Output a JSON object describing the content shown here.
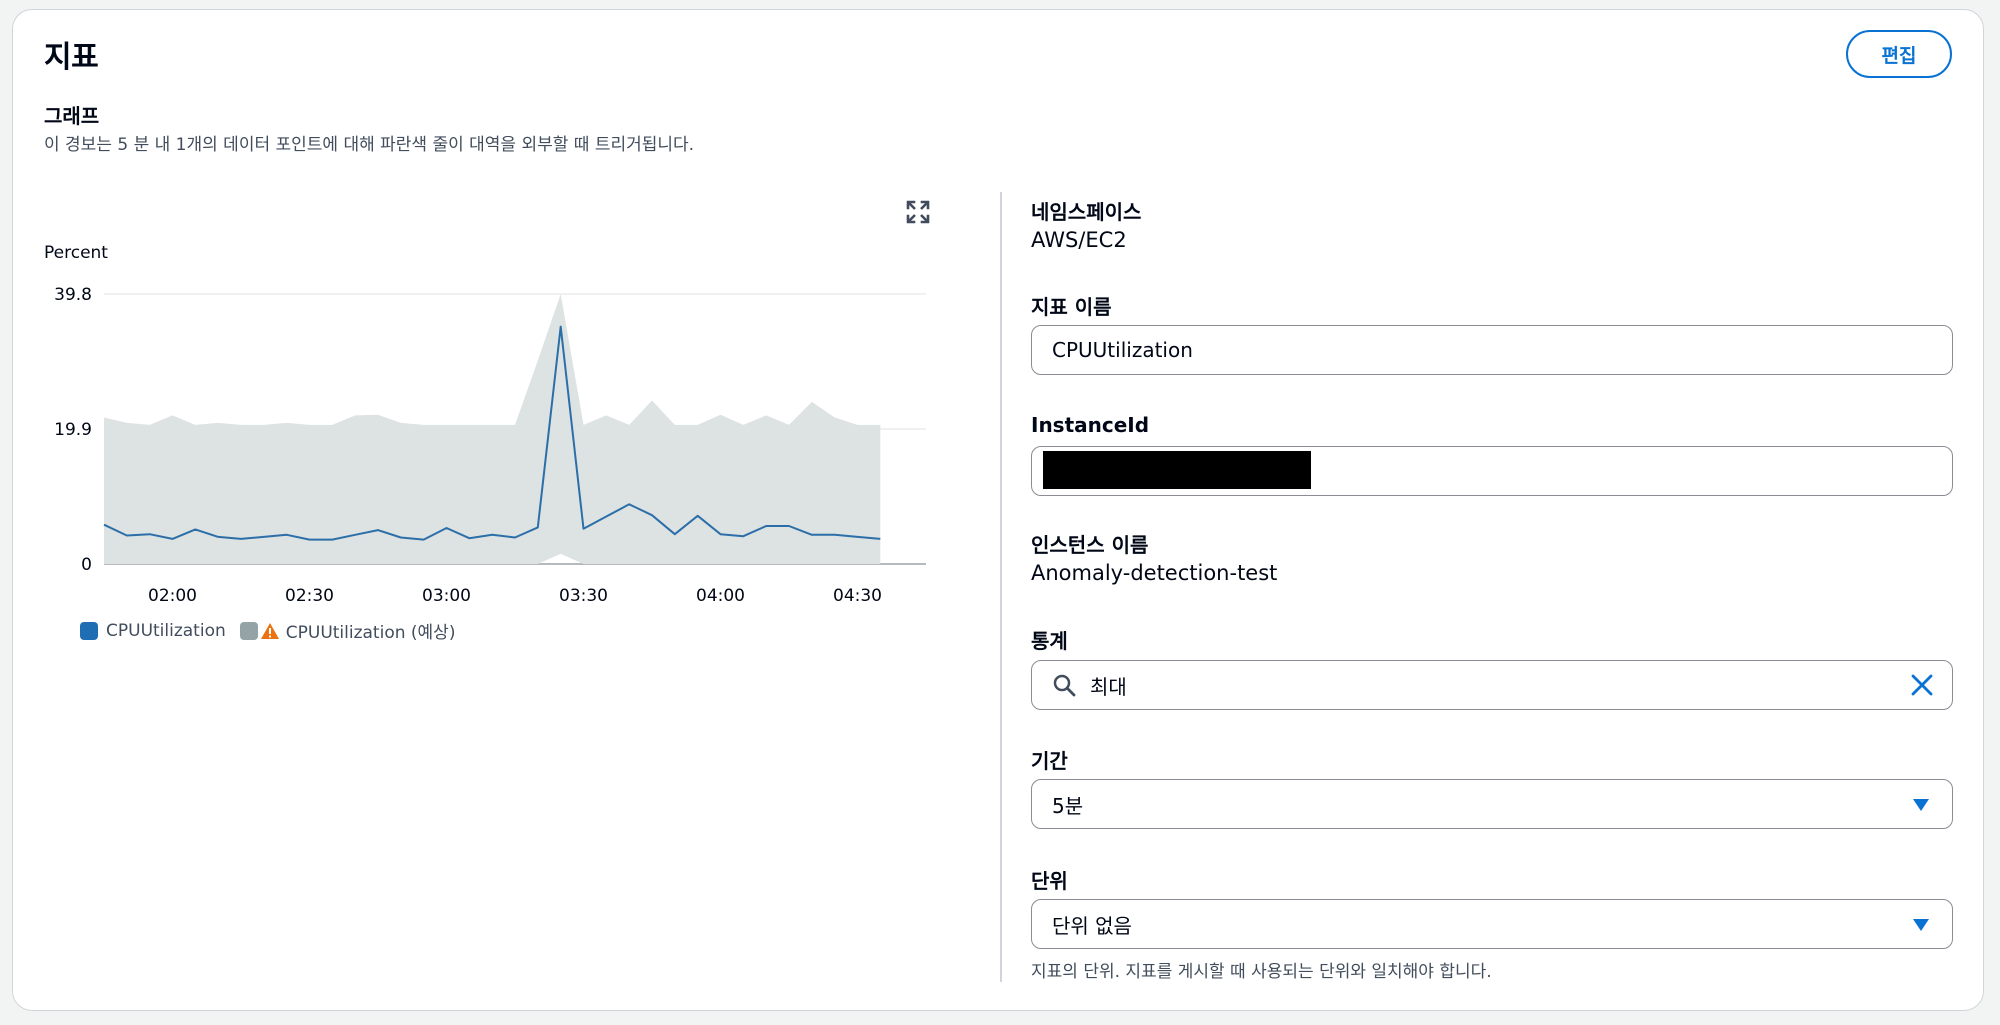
{
  "panel": {
    "title": "지표",
    "edit_label": "편집"
  },
  "graph": {
    "heading": "그래프",
    "description": "이 경보는 5 분 내 1개의 데이터 포인트에 대해 파란색 줄이 대역을 외부할 때 트리거됩니다.",
    "expand_icon": "expand-icon"
  },
  "chart_data": {
    "type": "area",
    "ylabel": "Percent",
    "ylim": [
      0,
      39.8
    ],
    "yticks": [
      "39.8",
      "19.9",
      "0"
    ],
    "xticks": [
      "02:00",
      "02:30",
      "03:00",
      "03:30",
      "04:00",
      "04:30"
    ],
    "x_start": "01:45",
    "x_step_minutes": 5,
    "series": [
      {
        "name": "CPUUtilization",
        "color": "#2c6fa8",
        "values": [
          5.8,
          4.2,
          4.4,
          3.7,
          5.1,
          4.0,
          3.7,
          4.0,
          4.3,
          3.6,
          3.6,
          4.3,
          5.0,
          3.9,
          3.6,
          5.3,
          3.8,
          4.3,
          3.9,
          5.4,
          35.0,
          5.2,
          7.0,
          8.8,
          7.2,
          4.4,
          7.1,
          4.4,
          4.1,
          5.6,
          5.6,
          4.3,
          4.3,
          4.0,
          3.7
        ]
      },
      {
        "name": "CPUUtilization (예상)",
        "color": "#b8c4c6",
        "upper": [
          21.6,
          20.8,
          20.5,
          21.9,
          20.5,
          20.8,
          20.5,
          20.5,
          20.8,
          20.5,
          20.5,
          21.9,
          22.0,
          20.8,
          20.5,
          20.5,
          20.5,
          20.5,
          20.5,
          30.0,
          39.8,
          20.5,
          21.9,
          20.5,
          24.1,
          20.5,
          20.5,
          22.0,
          20.5,
          21.9,
          20.5,
          23.9,
          21.6,
          20.5,
          20.5
        ],
        "lower": [
          0,
          0,
          0,
          0,
          0,
          0,
          0,
          0,
          0,
          0,
          0,
          0,
          0,
          0,
          0,
          0,
          0,
          0,
          0,
          0,
          1.5,
          0,
          0,
          0,
          0,
          0,
          0,
          0,
          0,
          0,
          0,
          0,
          0,
          0,
          0
        ]
      }
    ],
    "legend_position": "bottom-left"
  },
  "legend": {
    "series1": "CPUUtilization",
    "series2": "CPUUtilization (예상)",
    "series1_color": "#1f6eb4",
    "series2_color": "#93a3a6",
    "warning_color": "#ec7211"
  },
  "fields": {
    "namespace_label": "네임스페이스",
    "namespace_value": "AWS/EC2",
    "metric_name_label": "지표 이름",
    "metric_name_value": "CPUUtilization",
    "instance_id_label": "InstanceId",
    "instance_name_label": "인스턴스 이름",
    "instance_name_value": "Anomaly-detection-test",
    "statistic_label": "통계",
    "statistic_value": "최대",
    "period_label": "기간",
    "period_value": "5분",
    "unit_label": "단위",
    "unit_value": "단위 없음",
    "unit_hint": "지표의 단위. 지표를 게시할 때 사용되는 단위와 일치해야 합니다."
  },
  "colors": {
    "accent": "#0972d3",
    "border": "#8c8c94"
  }
}
